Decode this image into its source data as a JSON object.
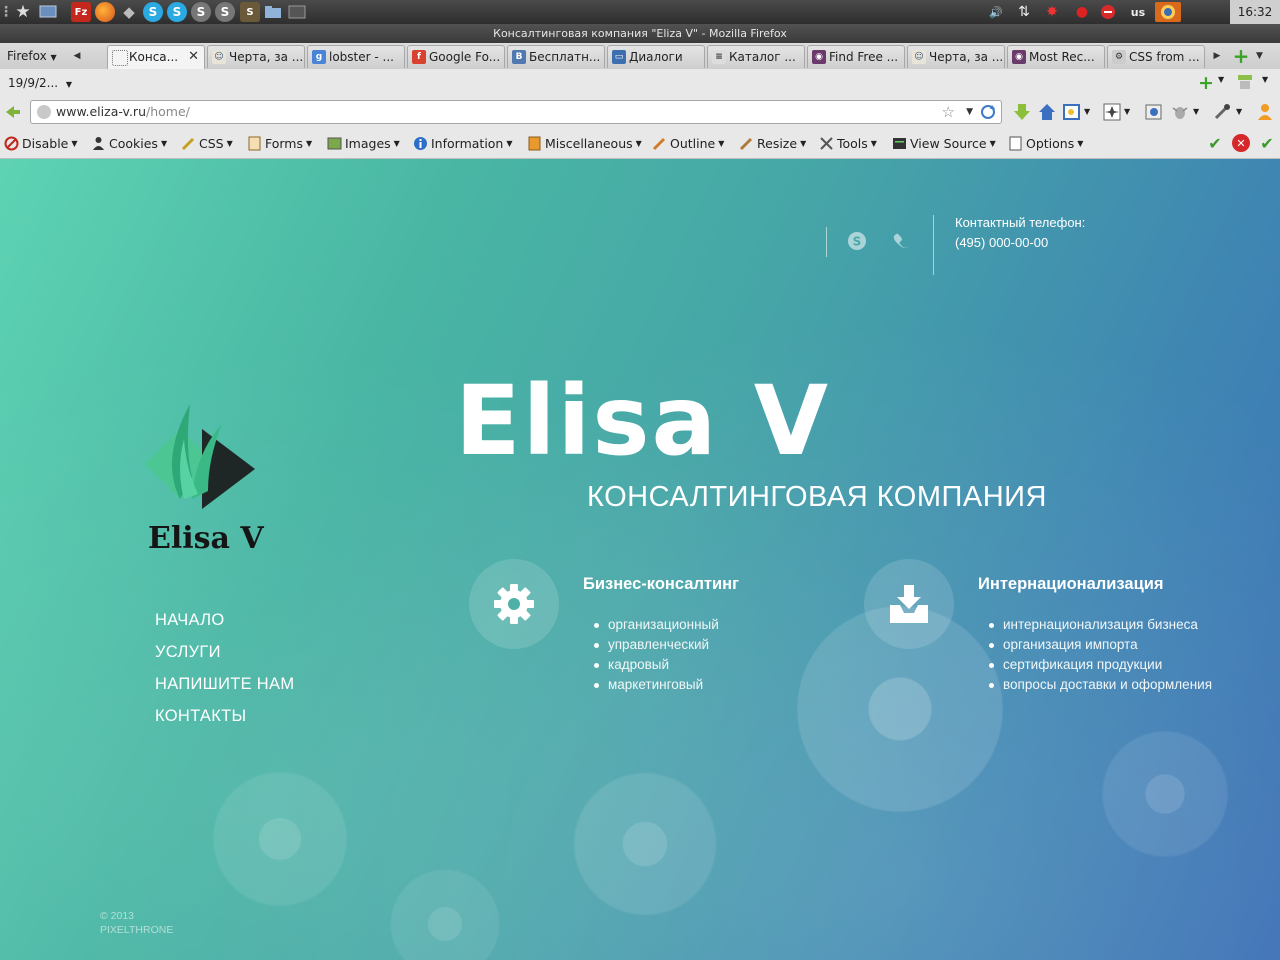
{
  "system_panel": {
    "clock": "16:32",
    "keyboard_layout": "us",
    "launchers": [
      "star-icon",
      "desktop-icon",
      "filezilla-icon",
      "firefox-icon",
      "wine-icon",
      "skype-icon",
      "skype-icon",
      "steam-icon",
      "steam-icon",
      "sublime-icon",
      "files-icon",
      "terminal-icon"
    ],
    "colors": {
      "panel": "#3a3a3a",
      "clock_bg": "#cfcfcf"
    }
  },
  "window": {
    "title": "Консалтинговая компания \"Eliza V\" - Mozilla Firefox"
  },
  "tabs": {
    "menu_label": "Firefox",
    "items": [
      {
        "label": "Конса...",
        "icon": "blank-page-icon",
        "active": true
      },
      {
        "label": "Черта, за ...",
        "icon": "user-icon"
      },
      {
        "label": "lobster - ...",
        "icon": "google-icon"
      },
      {
        "label": "Google Fo...",
        "icon": "font-icon"
      },
      {
        "label": "Бесплатн...",
        "icon": "vk-icon"
      },
      {
        "label": "Диалоги",
        "icon": "chat-icon"
      },
      {
        "label": "Каталог ...",
        "icon": "list-icon"
      },
      {
        "label": "Find Free ...",
        "icon": "theme-icon"
      },
      {
        "label": "Черта, за ...",
        "icon": "user-icon"
      },
      {
        "label": "Most Rec...",
        "icon": "theme-icon"
      },
      {
        "label": "CSS from ...",
        "icon": "gear-icon"
      }
    ]
  },
  "bookmarks_row": {
    "session_label": "19/9/2..."
  },
  "navigation": {
    "url_host": "www.eliza-v.ru",
    "url_path": "/home/"
  },
  "webdev_toolbar": {
    "items": [
      {
        "label": "Disable",
        "icon": "disable-icon"
      },
      {
        "label": "Cookies",
        "icon": "cookies-icon"
      },
      {
        "label": "CSS",
        "icon": "css-icon"
      },
      {
        "label": "Forms",
        "icon": "forms-icon"
      },
      {
        "label": "Images",
        "icon": "images-icon"
      },
      {
        "label": "Information",
        "icon": "information-icon"
      },
      {
        "label": "Miscellaneous",
        "icon": "miscellaneous-icon"
      },
      {
        "label": "Outline",
        "icon": "outline-icon"
      },
      {
        "label": "Resize",
        "icon": "resize-icon"
      },
      {
        "label": "Tools",
        "icon": "tools-icon"
      },
      {
        "label": "View Source",
        "icon": "view-source-icon"
      },
      {
        "label": "Options",
        "icon": "options-icon"
      }
    ]
  },
  "site": {
    "colors": {
      "accent_teal": "#48c59a",
      "logo_dark": "#1f2a2a",
      "text": "#ffffff"
    },
    "contact": {
      "label": "Контактный телефон:",
      "phone": "(495) 000-00-00"
    },
    "hero": {
      "title": "Elisa V",
      "subtitle": "КОНСАЛТИНГОВАЯ КОМПАНИЯ"
    },
    "logo": {
      "text": "Elisa V"
    },
    "nav": [
      "НАЧАЛО",
      "УСЛУГИ",
      "НАПИШИТЕ НАМ",
      "КОНТАКТЫ"
    ],
    "services": [
      {
        "title": "Бизнес-консалтинг",
        "icon": "gear-icon",
        "items": [
          "организационный",
          "управленческий",
          "кадровый",
          "маркетинговый"
        ]
      },
      {
        "title": "Интернационализация",
        "icon": "download-icon",
        "items": [
          "интернационализация бизнеса",
          "организация импорта",
          "сертификация продукции",
          "вопросы доставки и оформления"
        ]
      }
    ],
    "footer": {
      "copyright": "© 2013",
      "credit": "PIXELTHRONE"
    }
  }
}
